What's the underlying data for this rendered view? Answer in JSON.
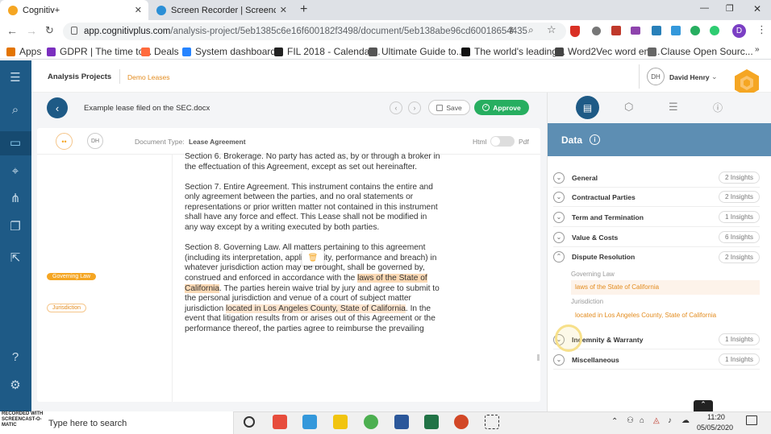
{
  "browser": {
    "tabs": [
      {
        "title": "Cognitiv+",
        "active": true
      },
      {
        "title": "Screen Recorder | Screencast-O-M",
        "active": false
      }
    ],
    "new_tab": "+",
    "url_host": "app.cognitivplus.com",
    "url_path": "/analysis-project/5eb1385c6e16f600182f3498/document/5eb138abe96cd60018654435",
    "profile_initial": "D",
    "window_controls": [
      "—",
      "❐",
      "✕"
    ],
    "bookmarks": [
      {
        "label": "Apps",
        "color": "#e37400"
      },
      {
        "label": "GDPR | The time to...",
        "color": "#7b2fbf"
      },
      {
        "label": "Deals",
        "color": "#ff6a3d"
      },
      {
        "label": "System dashboard...",
        "color": "#2684ff"
      },
      {
        "label": "FIL 2018 - Calendar...",
        "color": "#222222"
      },
      {
        "label": "Ultimate Guide to...",
        "color": "#555555"
      },
      {
        "label": "The world's leading...",
        "color": "#111111"
      },
      {
        "label": "Word2Vec word em...",
        "color": "#444444"
      },
      {
        "label": "Clause Open Sourc...",
        "color": "#666666"
      }
    ]
  },
  "app": {
    "breadcrumb_root": "Analysis Projects",
    "breadcrumb_project": "Demo Leases",
    "user_initials": "DH",
    "user_name": "David Henry",
    "doc_title": "Example lease filed on the SEC.docx",
    "save_label": "Save",
    "approve_label": "Approve",
    "doc_type_label": "Document Type:",
    "doc_type_value": "Lease Agreement",
    "avatar_initials": "DH",
    "view_html": "Html",
    "view_pdf": "Pdf",
    "tags": {
      "governing_law": "Governing Law",
      "jurisdiction": "Jurisdiction"
    },
    "doc": {
      "s6": "Section 6.  Brokerage.  No party has acted as, by or through a broker in the effectuation of this Agreement, except as set out hereinafter.",
      "s7": "Section 7.  Entire Agreement.  This instrument contains the entire and only agreement between the parties, and no oral statements or representations or prior written matter not contained in this instrument shall have any force and effect. This Lease shall not be modified in any way except by a writing executed by both parties.",
      "s8_a": "Section 8.  Governing Law. All matters pertaining to this agreement (including its interpretation, applic",
      "s8_b": "validity, performance and breach) in whatever jurisdiction action may be brought, shall be governed by, construed and enforced in accordance with the ",
      "s8_hl1": "laws of the State of California",
      "s8_c": ". The parties herein waive trial by jury and agree to submit to the personal jurisdiction and venue of a court of subject matter jurisdiction ",
      "s8_hl2": "located in Los Angeles County, State of California",
      "s8_d": ".  In the event that litigation results from or arises out of this Agreement or the performance thereof, the parties agree to reimburse the prevailing"
    }
  },
  "panel": {
    "title": "Data",
    "categories": [
      {
        "name": "General",
        "insights": "2 Insights"
      },
      {
        "name": "Contractual Parties",
        "insights": "2 Insights"
      },
      {
        "name": "Term and Termination",
        "insights": "1 Insights"
      },
      {
        "name": "Value & Costs",
        "insights": "6 Insights"
      },
      {
        "name": "Dispute Resolution",
        "insights": "2 Insights"
      },
      {
        "name": "Indemnity & Warranty",
        "insights": "1 Insights"
      },
      {
        "name": "Miscellaneous",
        "insights": "1 Insights"
      }
    ],
    "dispute": {
      "gov_label": "Governing Law",
      "gov_value": "laws of the State of California",
      "jur_label": "Jurisdiction",
      "jur_value": "located in Los Angeles County, State of California"
    }
  },
  "taskbar": {
    "search": "Type here to search",
    "time": "11:20",
    "date": "05/05/2020",
    "watermark": "RECORDED WITH SCREENCAST-O-MATIC"
  },
  "colors": {
    "accent": "#1e5a86",
    "approve": "#27ae60",
    "highlight": "#fbd9b5",
    "tag": "#f5a623"
  }
}
